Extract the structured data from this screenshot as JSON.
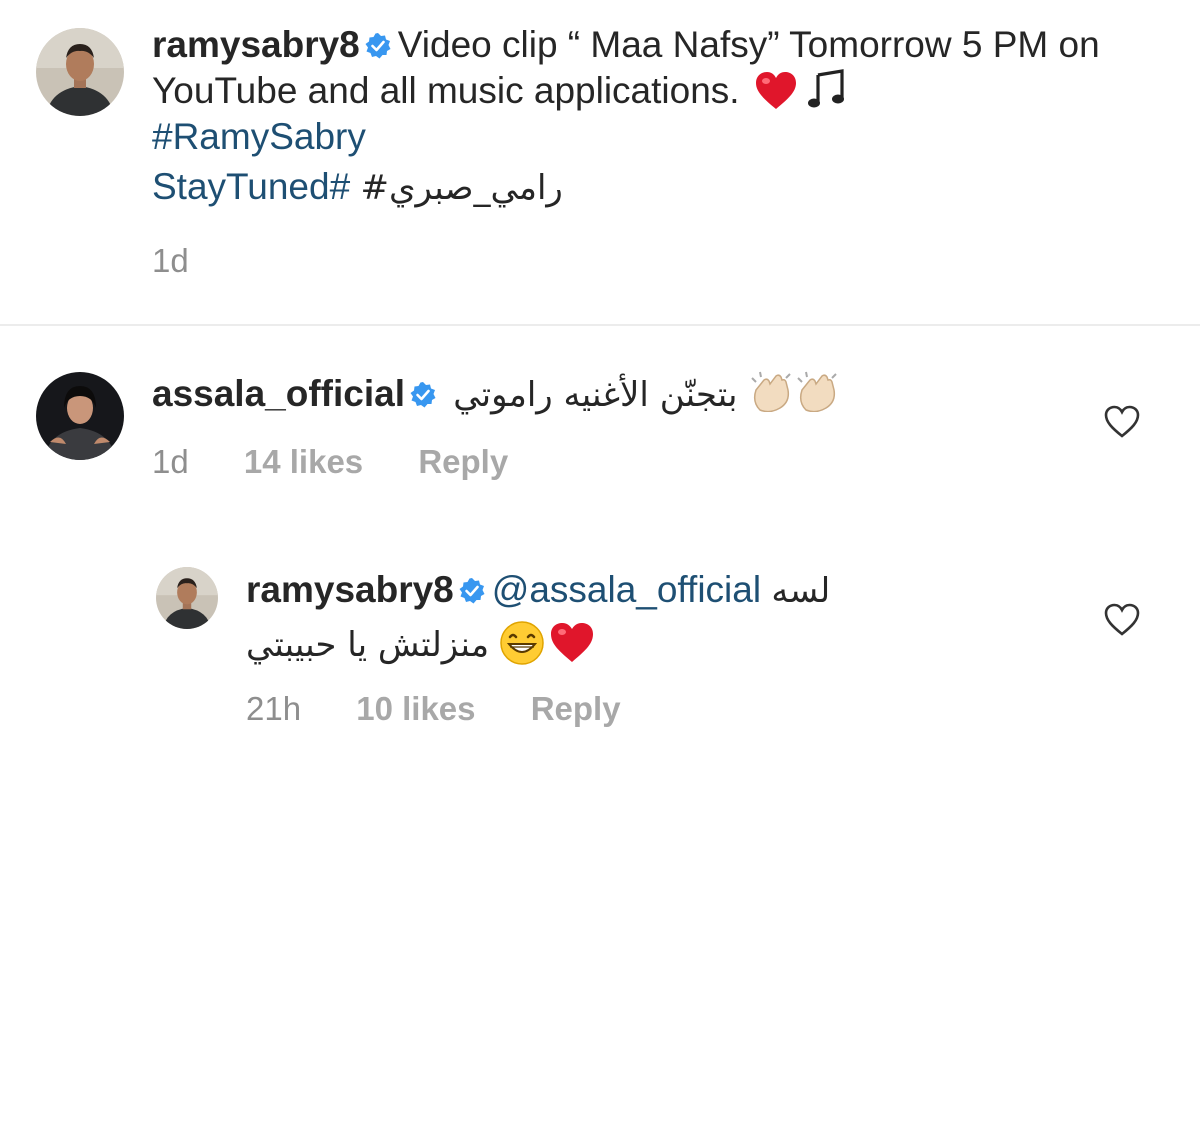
{
  "post": {
    "username": "ramysabry8",
    "caption": "Video clip “ Maa Nafsy” Tomorrow 5 PM on YouTube and all music applications.",
    "hashtag_1": "#RamySabry",
    "hashtag_2": "StayTuned#",
    "hashtag_3": "#رامي_صبري",
    "time": "1d",
    "emojis": [
      "red-heart-icon",
      "music-note-icon"
    ]
  },
  "comments": [
    {
      "username": "assala_official",
      "text": "بتجنّن الأغنيه راموتي",
      "emojis": [
        "clapping-hands-icon",
        "clapping-hands-icon"
      ],
      "time": "1d",
      "likes": "14 likes",
      "reply_label": "Reply"
    },
    {
      "username": "ramysabry8",
      "mention": "@assala_official",
      "text_line1": "لسه",
      "text_line2": "منزلتش يا حبيبتي",
      "emojis": [
        "grinning-face-icon",
        "red-heart-icon"
      ],
      "time": "21h",
      "likes": "10 likes",
      "reply_label": "Reply"
    }
  ],
  "colors": {
    "verified_badge": "#3897f0",
    "hashtag": "#1e4f73",
    "meta_text": "#8e8e8e",
    "heart": "#e0162b"
  }
}
